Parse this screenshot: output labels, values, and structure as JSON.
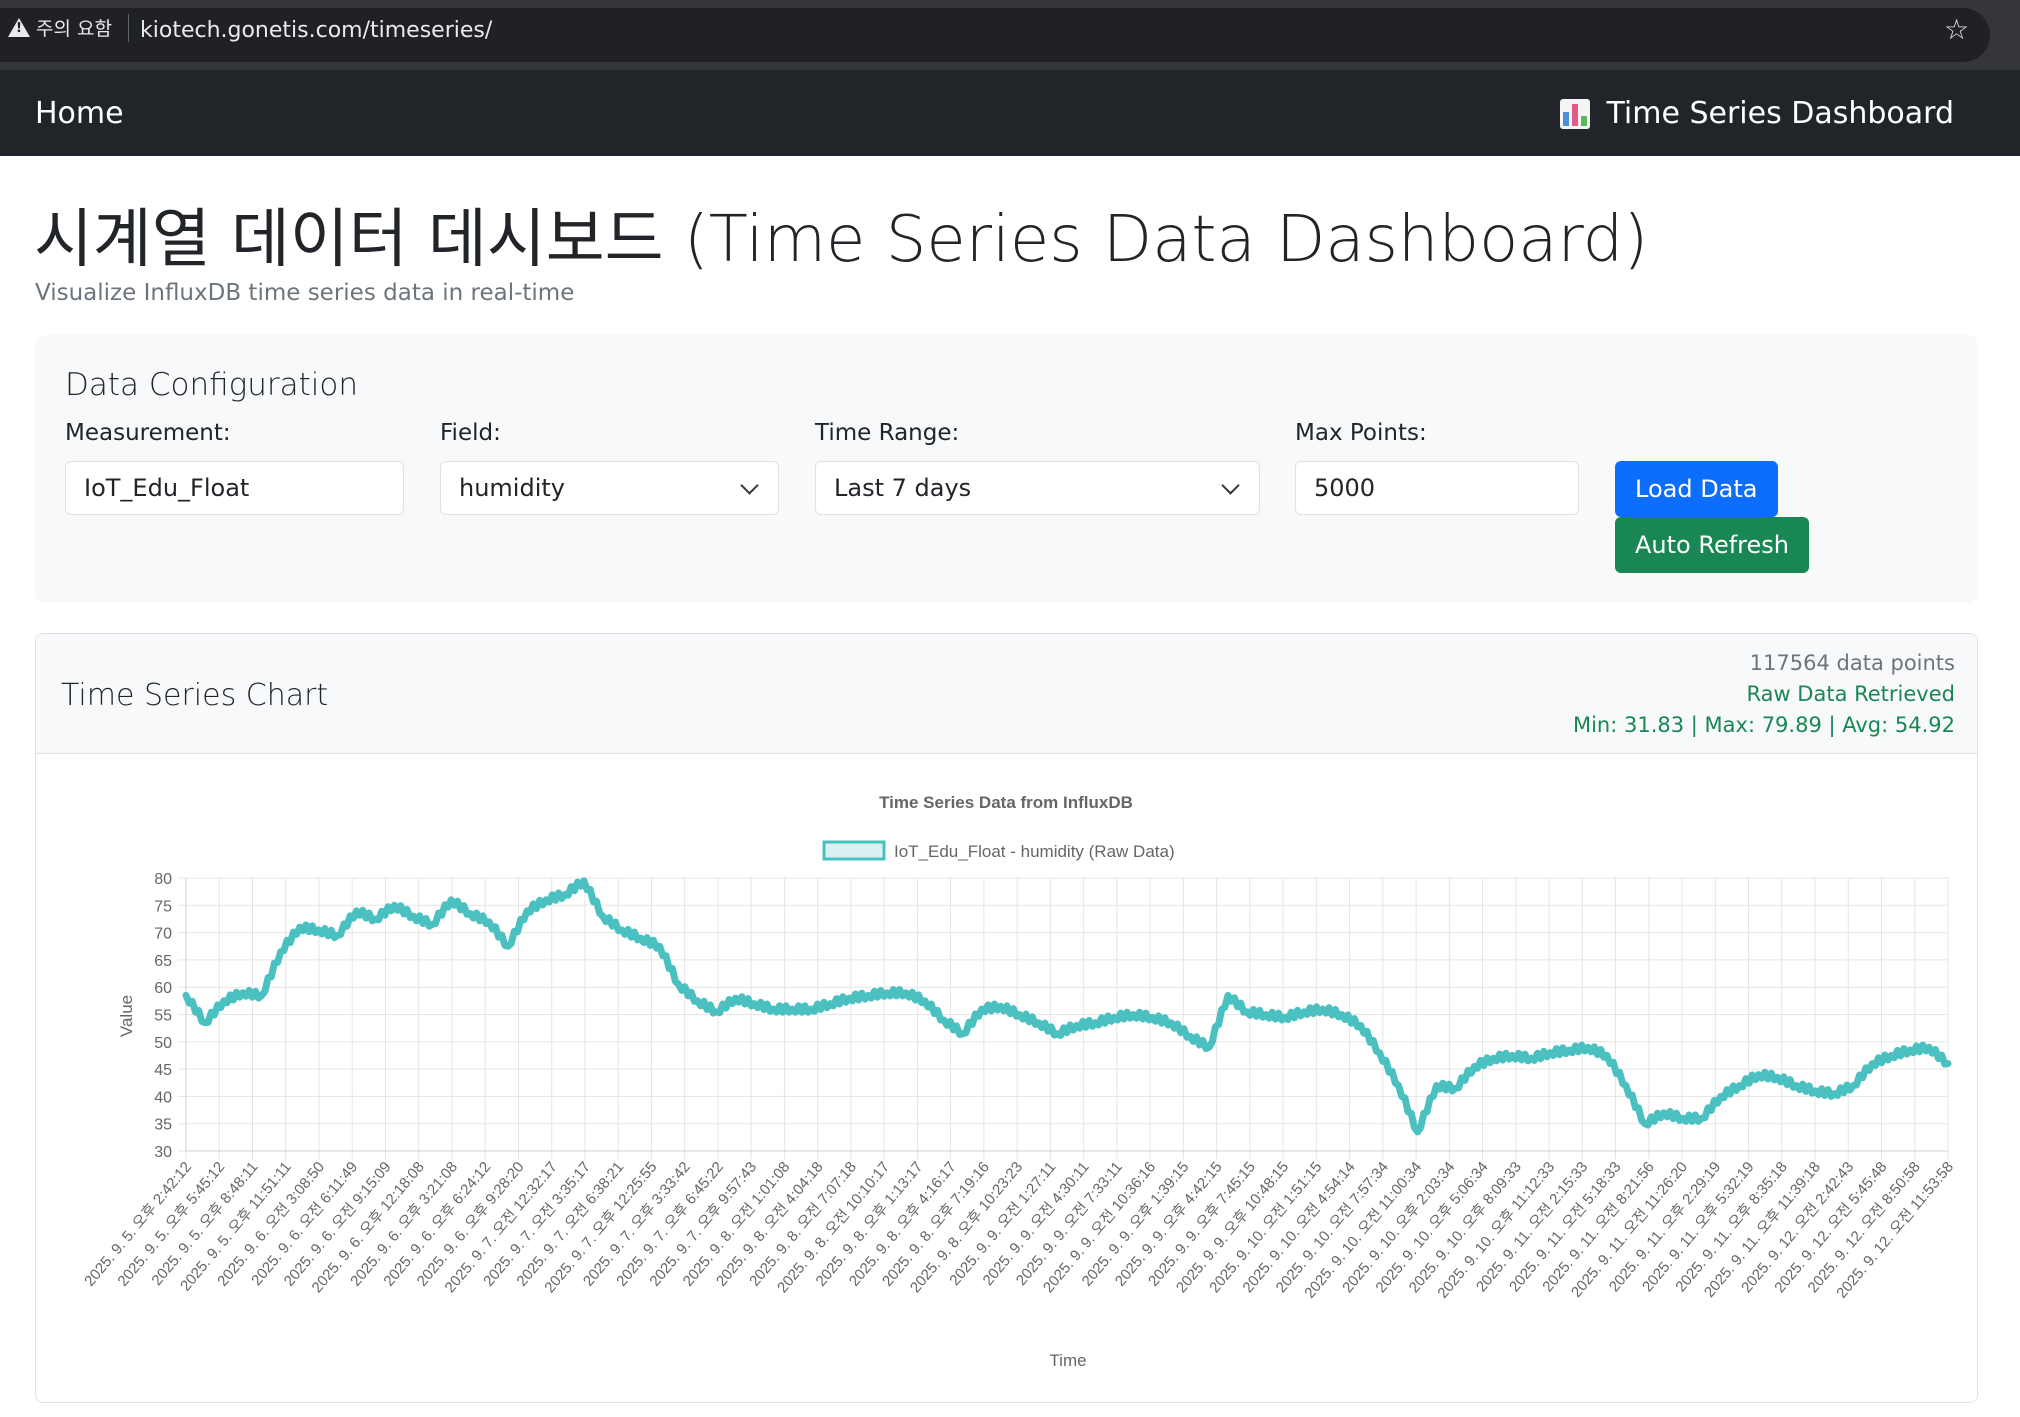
{
  "browser": {
    "security_label": "주의 요함",
    "url": "kiotech.gonetis.com/timeseries/",
    "star_icon": "star-icon"
  },
  "navbar": {
    "home_label": "Home",
    "brand_label": "Time Series Dashboard",
    "brand_icon": "bar-chart-icon"
  },
  "page": {
    "title": "시계열 데이터 데시보드 (Time Series Data Dashboard)",
    "subtitle": "Visualize InfluxDB time series data in real-time"
  },
  "config": {
    "title": "Data Configuration",
    "measurement_label": "Measurement:",
    "measurement_value": "IoT_Edu_Float",
    "field_label": "Field:",
    "field_value": "humidity",
    "time_range_label": "Time Range:",
    "time_range_value": "Last 7 days",
    "max_points_label": "Max Points:",
    "max_points_value": "5000",
    "load_button": "Load Data",
    "refresh_button": "Auto Refresh",
    "colors": {
      "primary": "#0d6efd",
      "success": "#198754"
    }
  },
  "chart_card": {
    "title": "Time Series Chart",
    "points_text": "117564 data points",
    "status_text": "Raw Data Retrieved",
    "stats_text": "Min: 31.83 | Max: 79.89 | Avg: 54.92"
  },
  "chart_data": {
    "type": "line",
    "title": "Time Series Data from InfluxDB",
    "xlabel": "Time",
    "ylabel": "Value",
    "ylim": [
      30,
      80
    ],
    "yticks": [
      30,
      35,
      40,
      45,
      50,
      55,
      60,
      65,
      70,
      75,
      80
    ],
    "grid": true,
    "legend": "top-center",
    "line_color": "#4bc0c0",
    "fill_color": "rgba(75,192,192,0.2)",
    "xticks": [
      "2025. 9. 5. 오후 2:42:12",
      "2025. 9. 5. 오후 5:45:12",
      "2025. 9. 5. 오후 8:48:11",
      "2025. 9. 5. 오후 11:51:11",
      "2025. 9. 6. 오전 3:08:50",
      "2025. 9. 6. 오전 6:11:49",
      "2025. 9. 6. 오전 9:15:09",
      "2025. 9. 6. 오후 12:18:08",
      "2025. 9. 6. 오후 3:21:08",
      "2025. 9. 6. 오후 6:24:12",
      "2025. 9. 6. 오후 9:28:20",
      "2025. 9. 7. 오전 12:32:17",
      "2025. 9. 7. 오전 3:35:17",
      "2025. 9. 7. 오전 6:38:21",
      "2025. 9. 7. 오후 12:25:55",
      "2025. 9. 7. 오후 3:33:42",
      "2025. 9. 7. 오후 6:45:22",
      "2025. 9. 7. 오후 9:57:43",
      "2025. 9. 8. 오전 1:01:08",
      "2025. 9. 8. 오전 4:04:18",
      "2025. 9. 8. 오전 7:07:18",
      "2025. 9. 8. 오전 10:10:17",
      "2025. 9. 8. 오후 1:13:17",
      "2025. 9. 8. 오후 4:16:17",
      "2025. 9. 8. 오후 7:19:16",
      "2025. 9. 8. 오후 10:23:23",
      "2025. 9. 9. 오전 1:27:11",
      "2025. 9. 9. 오전 4:30:11",
      "2025. 9. 9. 오전 7:33:11",
      "2025. 9. 9. 오전 10:36:16",
      "2025. 9. 9. 오후 1:39:15",
      "2025. 9. 9. 오후 4:42:15",
      "2025. 9. 9. 오후 7:45:15",
      "2025. 9. 9. 오후 10:48:15",
      "2025. 9. 10. 오전 1:51:15",
      "2025. 9. 10. 오전 4:54:14",
      "2025. 9. 10. 오전 7:57:34",
      "2025. 9. 10. 오전 11:00:34",
      "2025. 9. 10. 오후 2:03:34",
      "2025. 9. 10. 오후 5:06:34",
      "2025. 9. 10. 오후 8:09:33",
      "2025. 9. 10. 오후 11:12:33",
      "2025. 9. 11. 오전 2:15:33",
      "2025. 9. 11. 오전 5:18:33",
      "2025. 9. 11. 오전 8:21:56",
      "2025. 9. 11. 오전 11:26:20",
      "2025. 9. 11. 오후 2:29:19",
      "2025. 9. 11. 오후 5:32:19",
      "2025. 9. 11. 오후 8:35:18",
      "2025. 9. 11. 오후 11:39:18",
      "2025. 9. 12. 오전 2:42:43",
      "2025. 9. 12. 오전 5:45:48",
      "2025. 9. 12. 오전 8:50:58",
      "2025. 9. 12. 오전 11:53:58"
    ],
    "series": [
      {
        "name": "IoT_Edu_Float - humidity (Raw Data)",
        "values": [
          58.5,
          53.5,
          57.5,
          59.0,
          58.5,
          66.5,
          71.0,
          70.5,
          69.5,
          74.0,
          72.5,
          75.0,
          73.0,
          71.5,
          76.0,
          73.5,
          72.0,
          67.5,
          74.0,
          76.0,
          77.0,
          79.5,
          73.0,
          70.5,
          69.0,
          67.5,
          60.5,
          57.5,
          55.5,
          58.0,
          57.0,
          56.0,
          56.0,
          56.0,
          57.0,
          58.0,
          58.5,
          59.0,
          59.0,
          57.5,
          54.0,
          51.5,
          56.0,
          56.5,
          55.0,
          53.5,
          51.5,
          53.0,
          53.5,
          54.5,
          55.0,
          54.5,
          53.5,
          51.0,
          49.0,
          58.5,
          55.5,
          55.0,
          54.5,
          55.5,
          56.0,
          55.0,
          53.0,
          48.0,
          42.0,
          33.5,
          42.0,
          41.5,
          45.5,
          47.0,
          47.5,
          47.0,
          48.0,
          48.5,
          49.0,
          47.5,
          42.0,
          35.0,
          37.0,
          36.0,
          36.0,
          40.0,
          42.0,
          44.0,
          43.5,
          42.0,
          41.0,
          40.5,
          42.0,
          46.0,
          47.5,
          48.5,
          49.0,
          46.0
        ]
      }
    ]
  }
}
